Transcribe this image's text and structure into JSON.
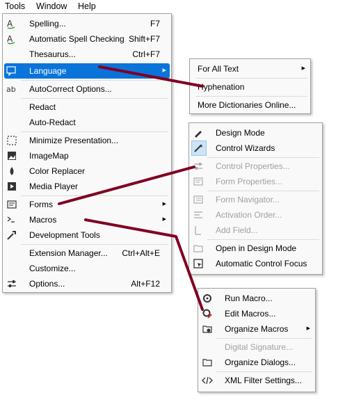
{
  "menubar": {
    "tools": "Tools",
    "window": "Window",
    "help": "Help"
  },
  "tools_menu": {
    "spelling": "Spelling...",
    "spelling_sc": "F7",
    "auto_spell": "Automatic Spell Checking",
    "auto_spell_sc": "Shift+F7",
    "thesaurus": "Thesaurus...",
    "thesaurus_sc": "Ctrl+F7",
    "language": "Language",
    "autocorrect": "AutoCorrect Options...",
    "redact": "Redact",
    "auto_redact": "Auto-Redact",
    "minimize": "Minimize Presentation...",
    "imagemap": "ImageMap",
    "color_replacer": "Color Replacer",
    "media_player": "Media Player",
    "forms": "Forms",
    "macros": "Macros",
    "dev_tools": "Development Tools",
    "ext_manager": "Extension Manager...",
    "ext_manager_sc": "Ctrl+Alt+E",
    "customize": "Customize...",
    "options": "Options...",
    "options_sc": "Alt+F12"
  },
  "language_menu": {
    "for_all_text": "For All Text",
    "hyphenation": "Hyphenation",
    "more_dicts": "More Dictionaries Online..."
  },
  "forms_menu": {
    "design_mode": "Design Mode",
    "control_wizards": "Control Wizards",
    "control_props": "Control Properties...",
    "form_props": "Form Properties...",
    "form_navigator": "Form Navigator...",
    "activation_order": "Activation Order...",
    "add_field": "Add Field...",
    "open_design": "Open in Design Mode",
    "auto_focus": "Automatic Control Focus"
  },
  "macros_menu": {
    "run": "Run Macro...",
    "edit": "Edit Macros...",
    "organize_macros": "Organize Macros",
    "digital_sig": "Digital Signature...",
    "organize_dialogs": "Organize Dialogs...",
    "xml_filter": "XML Filter Settings..."
  },
  "colors": {
    "highlight": "#0a74da",
    "connector": "#800020",
    "disabled": "#a0a0a0"
  }
}
